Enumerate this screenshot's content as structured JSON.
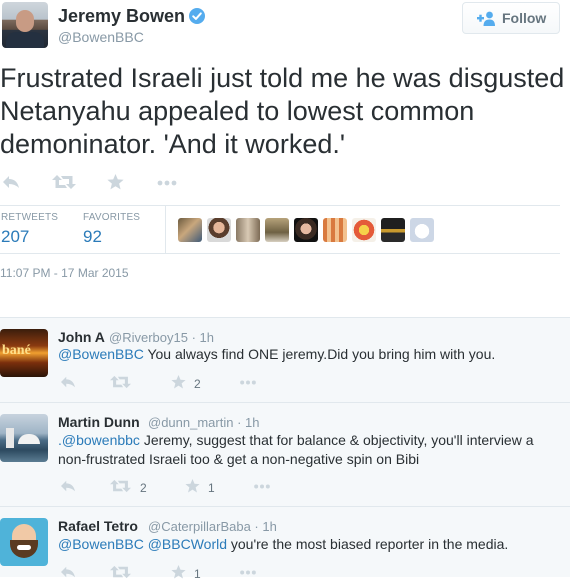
{
  "tweet": {
    "author_name": "Jeremy Bowen",
    "author_handle": "@BowenBBC",
    "follow_label": "Follow",
    "text": "Frustrated Israeli just told me he was disgusted Netanyahu appealed to lowest common demoninator. 'And it worked.'",
    "retweets_label": "RETWEETS",
    "retweets_count": "207",
    "favorites_label": "FAVORITES",
    "favorites_count": "92",
    "timestamp": "11:07 PM - 17 Mar 2015"
  },
  "colors": {
    "link": "#2b7bb9",
    "muted": "#8899a6",
    "verified": "#55acee",
    "icon": "#ccd6dd"
  },
  "replies": [
    {
      "name": "John A",
      "handle": "@Riverboy15",
      "time": "1h",
      "mention": "@BowenBBC",
      "text": " You always find ONE jeremy.Did you bring him with you.",
      "retweet_count": "",
      "favorite_count": "2"
    },
    {
      "name": "Martin Dunn",
      "handle": "@dunn_martin",
      "time": "1h",
      "mention": ".@bowenbbc",
      "text": " Jeremy, suggest that for balance & objectivity, you'll interview a non-frustrated Israeli too & get a non-negative spin on Bibi",
      "retweet_count": "2",
      "favorite_count": "1"
    },
    {
      "name": "Rafael Tetro",
      "handle": "@CaterpillarBaba",
      "time": "1h",
      "mention": "@BowenBBC @BBCWorld",
      "text": " you're the most biased reporter in the media.",
      "retweet_count": "",
      "favorite_count": "1"
    }
  ]
}
